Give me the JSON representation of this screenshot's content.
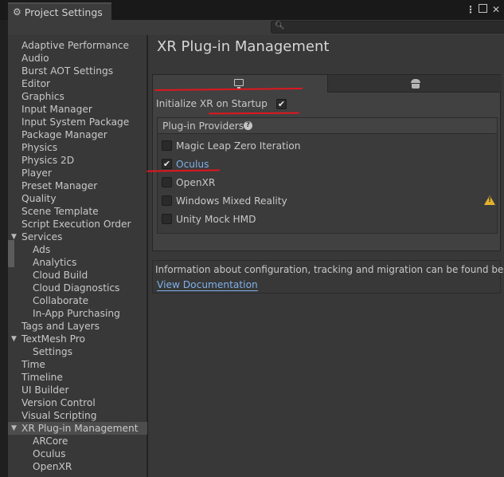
{
  "window": {
    "title": "Project Settings",
    "menu_glyph": "⋮",
    "close_glyph": "✕"
  },
  "sidebar": {
    "items": [
      {
        "label": "Adaptive Performance",
        "indent": 0
      },
      {
        "label": "Audio",
        "indent": 0
      },
      {
        "label": "Burst AOT Settings",
        "indent": 0
      },
      {
        "label": "Editor",
        "indent": 0
      },
      {
        "label": "Graphics",
        "indent": 0
      },
      {
        "label": "Input Manager",
        "indent": 0
      },
      {
        "label": "Input System Package",
        "indent": 0
      },
      {
        "label": "Package Manager",
        "indent": 0
      },
      {
        "label": "Physics",
        "indent": 0
      },
      {
        "label": "Physics 2D",
        "indent": 0
      },
      {
        "label": "Player",
        "indent": 0
      },
      {
        "label": "Preset Manager",
        "indent": 0
      },
      {
        "label": "Quality",
        "indent": 0
      },
      {
        "label": "Scene Template",
        "indent": 0
      },
      {
        "label": "Script Execution Order",
        "indent": 0
      },
      {
        "label": "Services",
        "indent": 0,
        "expanded": true
      },
      {
        "label": "Ads",
        "indent": 1
      },
      {
        "label": "Analytics",
        "indent": 1
      },
      {
        "label": "Cloud Build",
        "indent": 1
      },
      {
        "label": "Cloud Diagnostics",
        "indent": 1
      },
      {
        "label": "Collaborate",
        "indent": 1
      },
      {
        "label": "In-App Purchasing",
        "indent": 1
      },
      {
        "label": "Tags and Layers",
        "indent": 0
      },
      {
        "label": "TextMesh Pro",
        "indent": 0,
        "expanded": true
      },
      {
        "label": "Settings",
        "indent": 1
      },
      {
        "label": "Time",
        "indent": 0
      },
      {
        "label": "Timeline",
        "indent": 0
      },
      {
        "label": "UI Builder",
        "indent": 0
      },
      {
        "label": "Version Control",
        "indent": 0
      },
      {
        "label": "Visual Scripting",
        "indent": 0
      },
      {
        "label": "XR Plug-in Management",
        "indent": 0,
        "expanded": true,
        "selected": true
      },
      {
        "label": "ARCore",
        "indent": 1
      },
      {
        "label": "Oculus",
        "indent": 1
      },
      {
        "label": "OpenXR",
        "indent": 1
      }
    ]
  },
  "main": {
    "title": "XR Plug-in Management",
    "init_label": "Initialize XR on Startup",
    "init_checked": true,
    "providers_title": "Plug-in Providers",
    "help_glyph": "?",
    "providers": [
      {
        "label": "Magic Leap Zero Iteration",
        "checked": false
      },
      {
        "label": "Oculus",
        "checked": true
      },
      {
        "label": "OpenXR",
        "checked": false
      },
      {
        "label": "Windows Mixed Reality",
        "checked": false,
        "warning": true
      },
      {
        "label": "Unity Mock HMD",
        "checked": false
      }
    ],
    "info_text": "Information about configuration, tracking and migration can be found below.",
    "doc_link": "View Documentation"
  },
  "colors": {
    "accent_link": "#7fb0e8",
    "warning": "#e3b22e",
    "annotation": "#e0161e"
  }
}
